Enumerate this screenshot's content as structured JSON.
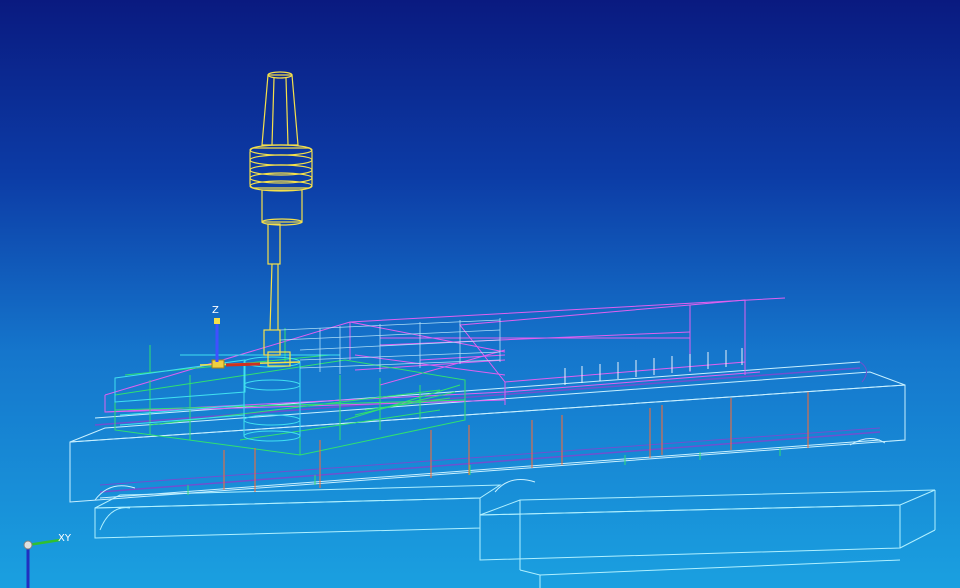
{
  "viewport": {
    "background_top": "#0a1a80",
    "background_bottom": "#1aa0e0"
  },
  "part_axis": {
    "z_label": "Z"
  },
  "world_axis": {
    "xy_label": "XY"
  },
  "colors": {
    "tool": "#f5e04a",
    "fixture": "#e060f0",
    "workpiece": "#30e070",
    "base": "#c8f0ff",
    "rail": "#8060c0",
    "toolpath": "#ff6a30",
    "leader": "#ffffff"
  },
  "icons": [
    "coordinate-axis-icon",
    "world-axis-icon"
  ]
}
